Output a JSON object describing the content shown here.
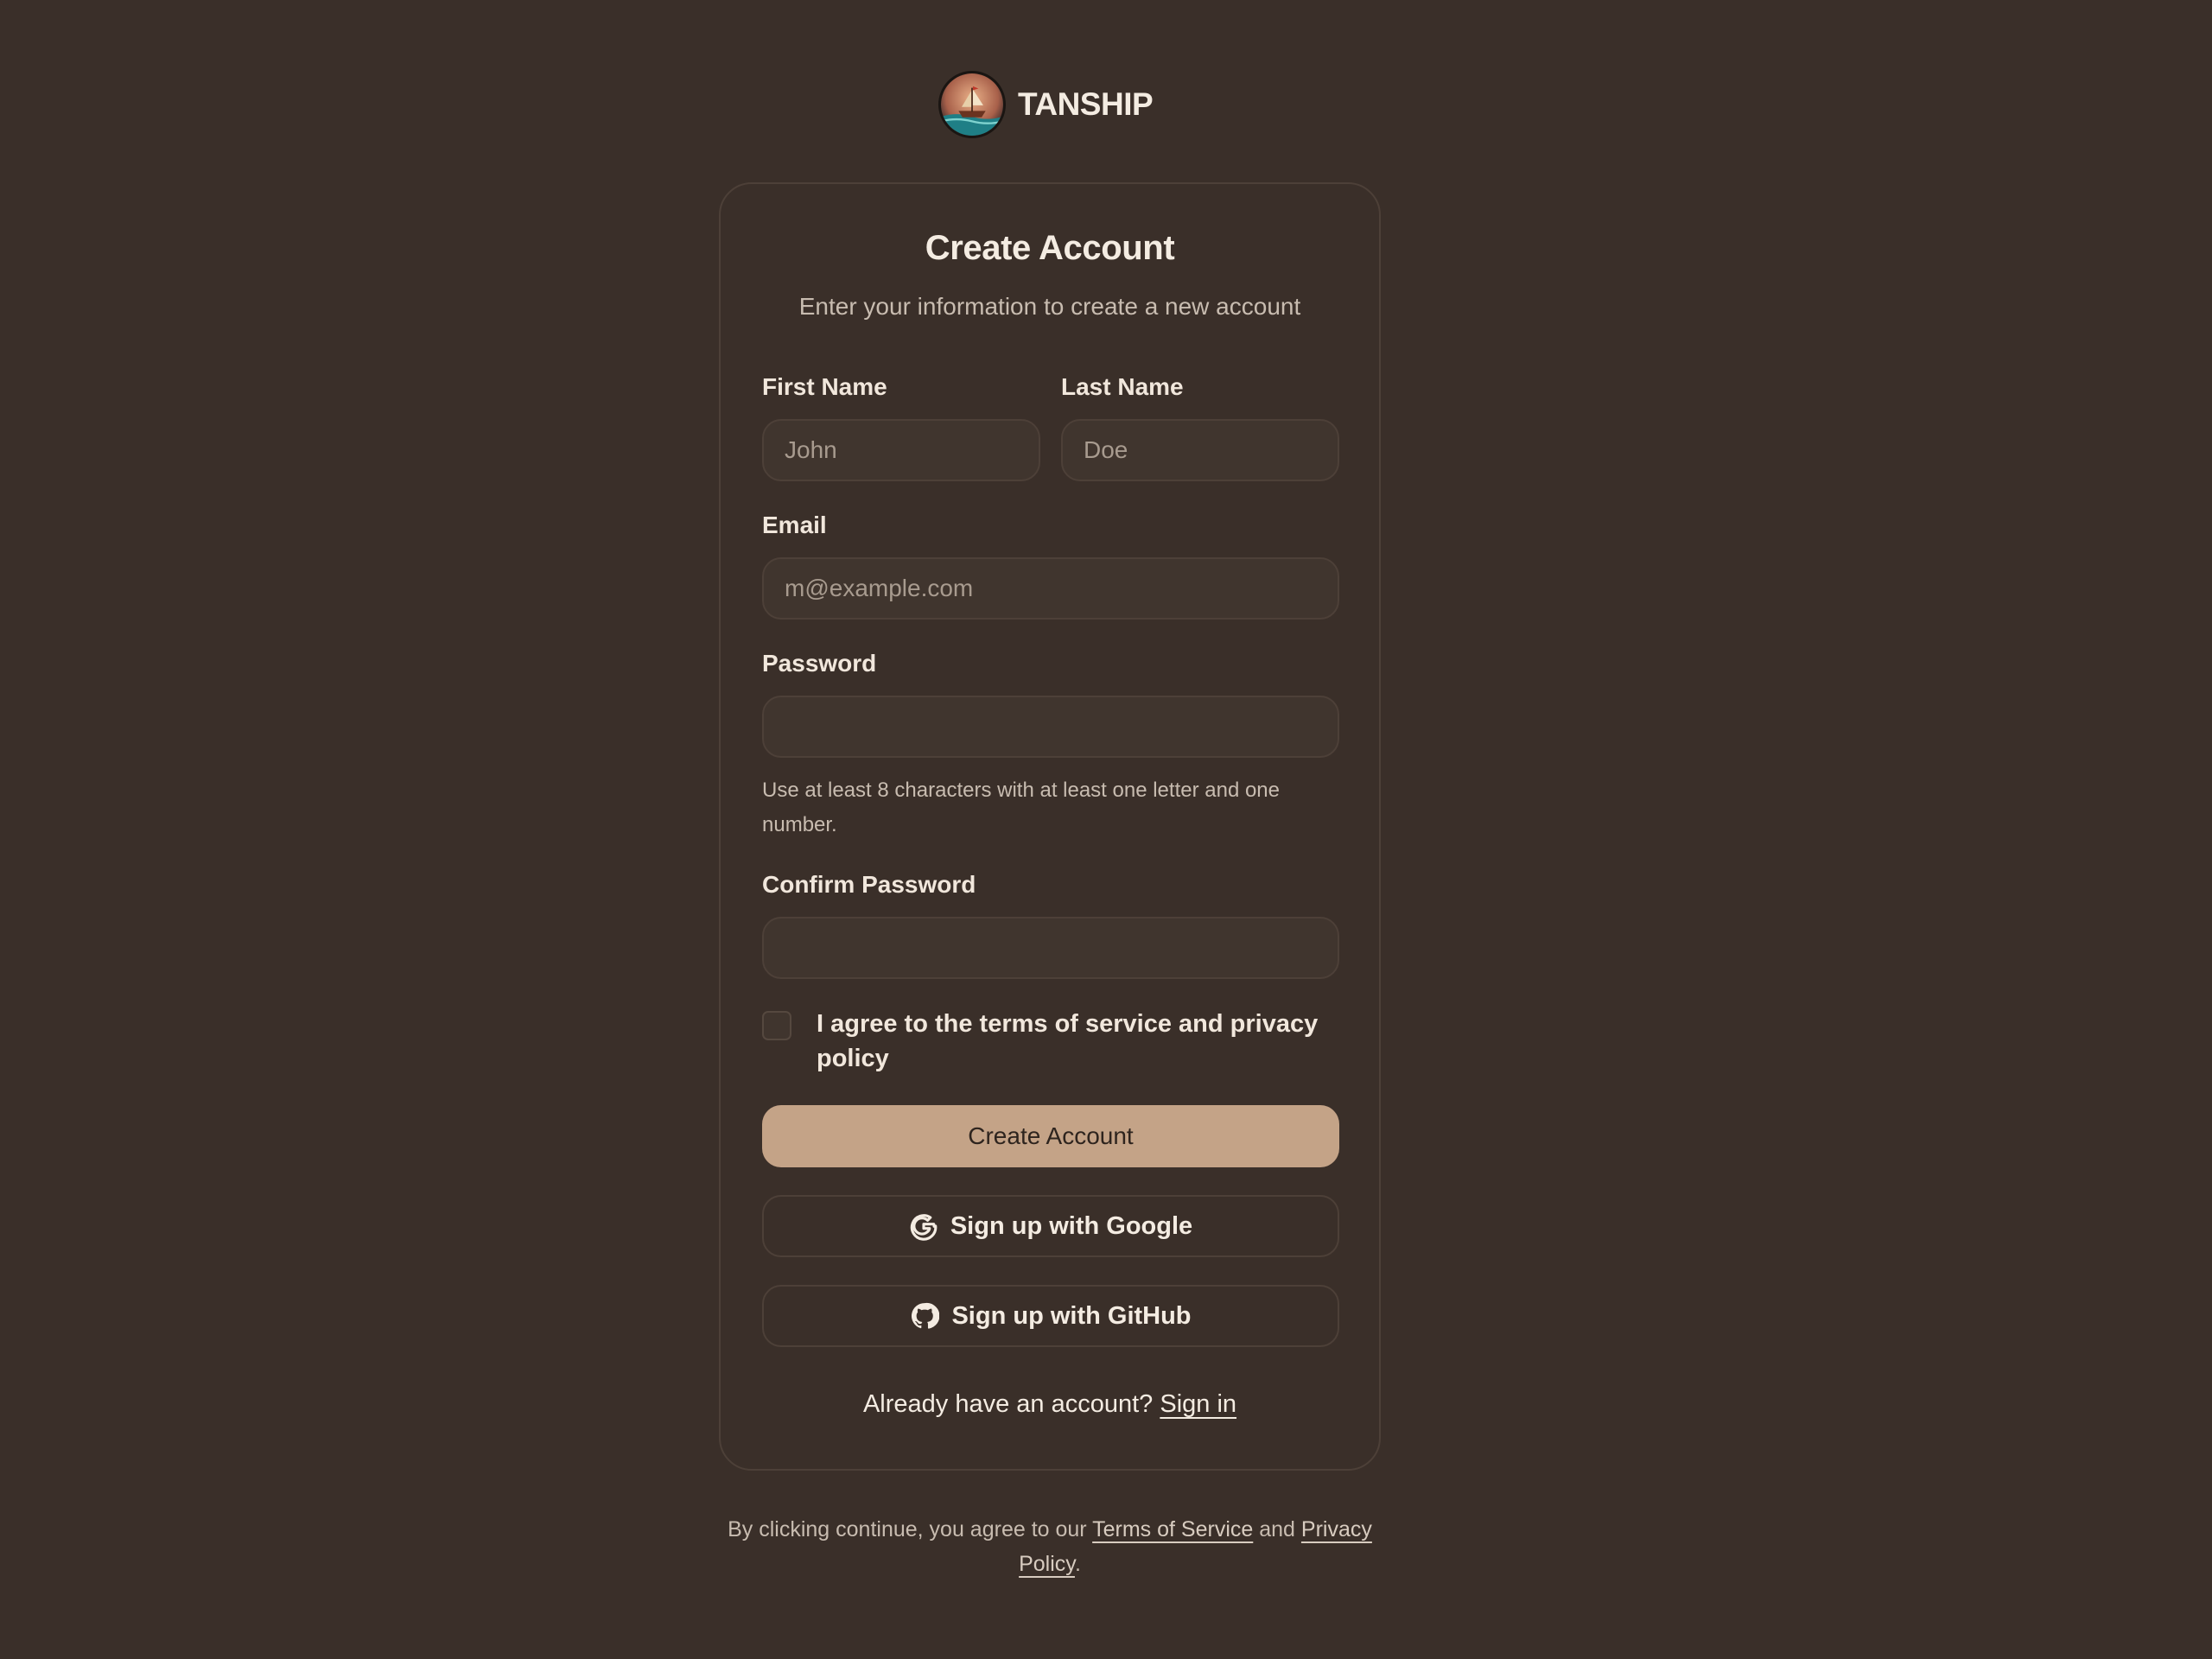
{
  "brand": {
    "name": "TANSHIP",
    "logo_icon": "ship-logo-icon"
  },
  "card": {
    "title": "Create Account",
    "subtitle": "Enter your information to create a new account"
  },
  "form": {
    "first_name": {
      "label": "First Name",
      "placeholder": "John",
      "value": ""
    },
    "last_name": {
      "label": "Last Name",
      "placeholder": "Doe",
      "value": ""
    },
    "email": {
      "label": "Email",
      "placeholder": "m@example.com",
      "value": ""
    },
    "password": {
      "label": "Password",
      "value": "",
      "hint": "Use at least 8 characters with at least one letter and one number."
    },
    "confirm_password": {
      "label": "Confirm Password",
      "value": ""
    },
    "terms_checkbox": {
      "label": "I agree to the terms of service and privacy policy",
      "checked": false
    }
  },
  "actions": {
    "create_account": "Create Account",
    "google": "Sign up with Google",
    "github": "Sign up with GitHub"
  },
  "signin": {
    "prompt": "Already have an account?",
    "link": "Sign in"
  },
  "footer": {
    "prefix": "By clicking continue, you agree to our",
    "terms_link": "Terms of Service",
    "and": "and",
    "privacy_link": "Privacy Policy",
    "suffix": "."
  },
  "colors": {
    "background": "#3a2f29",
    "primary_button": "#c4a387",
    "border": "#4d4038",
    "input_bg": "#40352e"
  }
}
